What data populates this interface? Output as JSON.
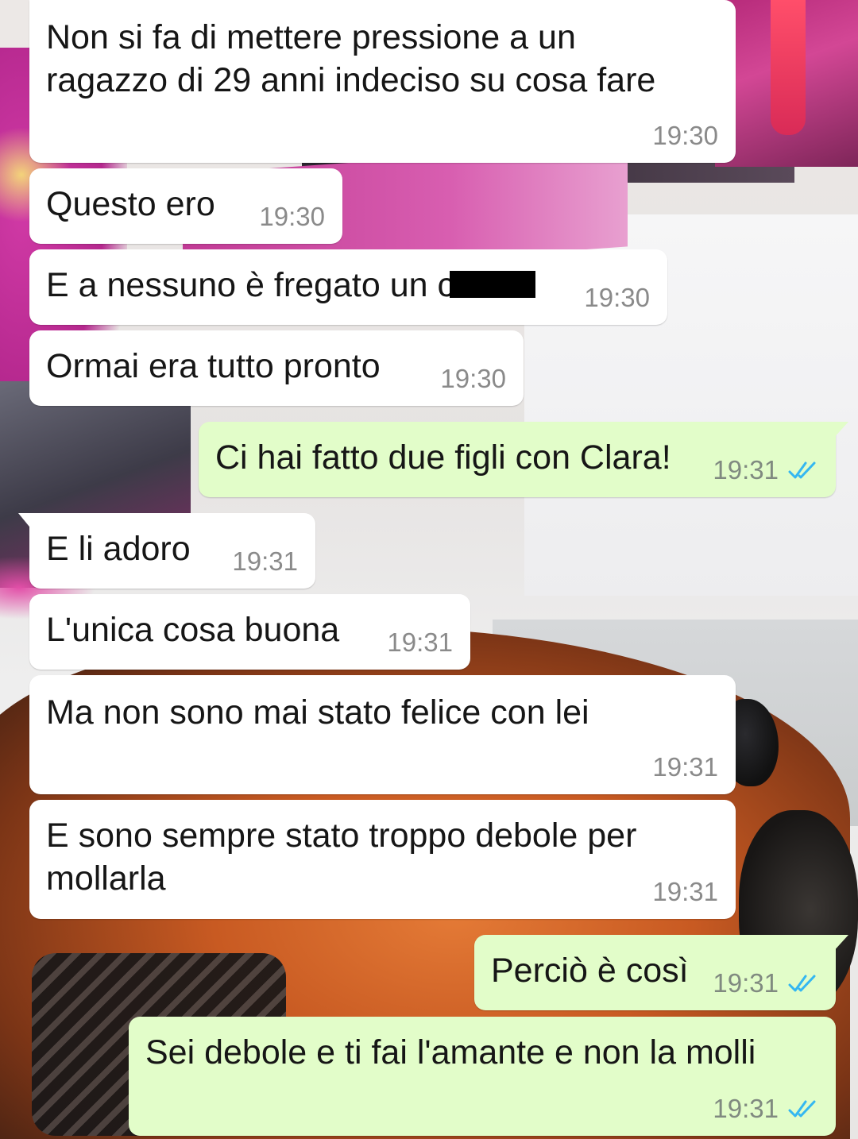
{
  "theme": {
    "incoming_bubble": "#ffffff",
    "outgoing_bubble": "#e2fdc9",
    "read_ticks": "#34b7f1"
  },
  "messages": [
    {
      "direction": "in",
      "lines": [
        "Non si fa di mettere pressione a un",
        "ragazzo di 29 anni indeciso su cosa fare"
      ],
      "time": "19:30"
    },
    {
      "direction": "in",
      "text": "Questo ero",
      "time": "19:30"
    },
    {
      "direction": "in",
      "text": "E a nessuno è fregato un c",
      "redacted": true,
      "time": "19:30"
    },
    {
      "direction": "in",
      "text": "Ormai era tutto pronto",
      "time": "19:30"
    },
    {
      "direction": "out",
      "text": "Ci hai fatto due figli con Clara!",
      "time": "19:31",
      "status": "read"
    },
    {
      "direction": "in",
      "text": "E li adoro",
      "time": "19:31"
    },
    {
      "direction": "in",
      "text": "L'unica cosa buona",
      "time": "19:31"
    },
    {
      "direction": "in",
      "text": "Ma non sono mai stato felice con lei",
      "time": "19:31"
    },
    {
      "direction": "in",
      "lines": [
        "E sono sempre stato troppo debole per",
        "mollarla"
      ],
      "time": "19:31"
    },
    {
      "direction": "out",
      "text": "Perciò è così",
      "time": "19:31",
      "status": "read"
    },
    {
      "direction": "out",
      "text": "Sei debole e ti fai l'amante e non la molli",
      "time": "19:31",
      "status": "read"
    }
  ]
}
